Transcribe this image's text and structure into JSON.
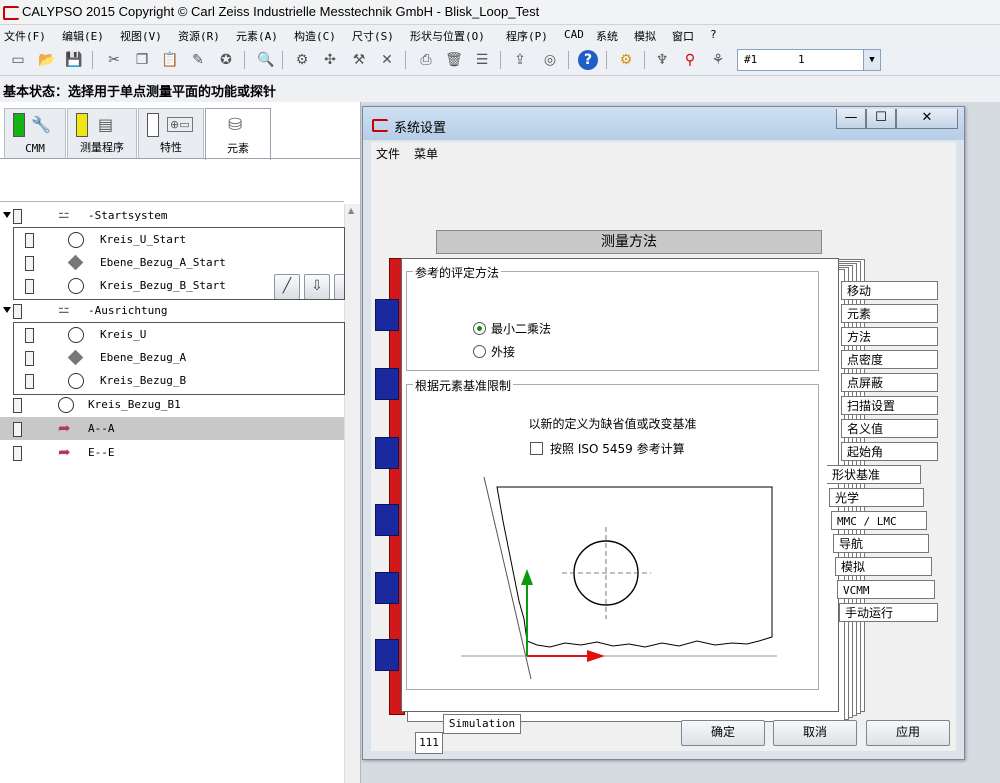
{
  "window": {
    "title": "CALYPSO 2015 Copyright © Carl Zeiss Industrielle Messtechnik GmbH - Blisk_Loop_Test"
  },
  "menu": [
    "文件(F)",
    "编辑(E)",
    "视图(V)",
    "资源(R)",
    "元素(A)",
    "构造(C)",
    "尺寸(S)",
    "形状与位置(O)",
    "程序(P)",
    "CAD",
    "系统",
    "模拟",
    "窗口",
    "?"
  ],
  "toolbar": {
    "icons": [
      "new-icon",
      "open-icon",
      "save-icon",
      "cut-icon",
      "copy-icon",
      "paste-icon",
      "probe-icon",
      "measure-icon",
      "search-icon",
      "ctr-icon",
      "wizard-icon",
      "tools-icon",
      "print-icon",
      "delete-icon",
      "list-icon",
      "export-icon",
      "settings-icon",
      "help-icon",
      "gear-icon",
      "stylus-icon",
      "stylus-alt-icon",
      "stylus-go-icon"
    ],
    "node_value": "#1",
    "node_count": "1"
  },
  "status": "基本状态：选择用于单点测量平面的功能或探针",
  "left_tabs": [
    {
      "label": "CMM",
      "color": "#14b414",
      "icon": "wrench-icon"
    },
    {
      "label": "测量程序",
      "color": "#f0e614",
      "icon": "program-icon"
    },
    {
      "label": "特性",
      "color": "#ffffff",
      "icon": "characteristic-icon"
    },
    {
      "label": "元素",
      "color": "",
      "icon": "elements-icon"
    }
  ],
  "tree": {
    "groups": [
      {
        "label": "-Startsystem",
        "items": [
          {
            "label": "Kreis_U_Start",
            "kind": "circle"
          },
          {
            "label": "Ebene_Bezug_A_Start",
            "kind": "plane"
          },
          {
            "label": "Kreis_Bezug_B_Start",
            "kind": "circle"
          }
        ]
      },
      {
        "label": "-Ausrichtung",
        "items": [
          {
            "label": "Kreis_U",
            "kind": "circle"
          },
          {
            "label": "Ebene_Bezug_A",
            "kind": "plane"
          },
          {
            "label": "Kreis_Bezug_B",
            "kind": "circle"
          }
        ]
      }
    ],
    "loose": [
      {
        "label": "Kreis_Bezug_B1",
        "kind": "circle"
      },
      {
        "label": "A--A",
        "kind": "section"
      },
      {
        "label": "E--E",
        "kind": "section"
      }
    ]
  },
  "dialog": {
    "title": "系统设置",
    "menu": [
      "文件",
      "菜单"
    ],
    "header": "测量方法",
    "group1": {
      "caption": "参考的评定方法",
      "options": [
        "最小二乘法",
        "外接"
      ],
      "selected": 0
    },
    "group2": {
      "caption": "根据元素基准限制",
      "text": "以新的定义为缺省值或改变基准",
      "checkbox": "按照 ISO 5459 参考计算",
      "checked": false
    },
    "side_tabs": [
      "移动",
      "元素",
      "方法",
      "点密度",
      "点屏蔽",
      "扫描设置",
      "名义值",
      "起始角",
      "形状基准",
      "光学",
      "MMC / LMC",
      "导航",
      "模拟",
      "VCMM",
      "手动运行"
    ],
    "bottom_tabs": [
      "Simulation",
      "111"
    ],
    "buttons": [
      "确定",
      "取消",
      "应用"
    ]
  }
}
